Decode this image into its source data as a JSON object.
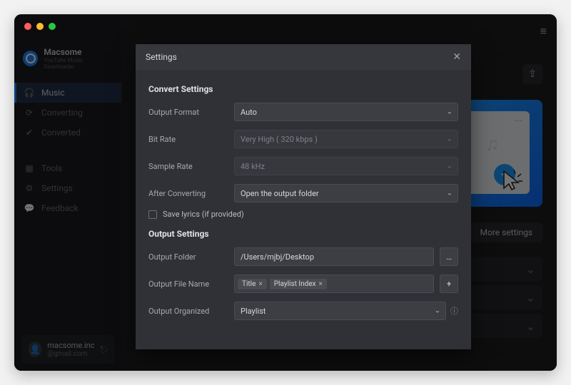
{
  "brand": {
    "name": "Macsome",
    "sub": "YouTube Music Downloader"
  },
  "sidebar": {
    "items": [
      {
        "label": "Music"
      },
      {
        "label": "Converting"
      },
      {
        "label": "Converted"
      },
      {
        "label": "Tools"
      },
      {
        "label": "Settings"
      },
      {
        "label": "Feedback"
      }
    ]
  },
  "account": {
    "name": "macsome.inc",
    "mail": "@gmail.com"
  },
  "main": {
    "more_btn": "More settings"
  },
  "modal": {
    "title": "Settings",
    "sections": {
      "convert_title": "Convert Settings",
      "output_title": "Output Settings"
    },
    "labels": {
      "output_format": "Output Format",
      "bit_rate": "Bit Rate",
      "sample_rate": "Sample Rate",
      "after_converting": "After Converting",
      "save_lyrics": "Save lyrics (if provided)",
      "output_folder": "Output Folder",
      "output_file_name": "Output File Name",
      "output_organized": "Output Organized"
    },
    "values": {
      "output_format": "Auto",
      "bit_rate": "Very High ( 320 kbps )",
      "sample_rate": "48 kHz",
      "after_converting": "Open the output folder",
      "output_folder": "/Users/mjbj/Desktop",
      "output_organized": "Playlist"
    },
    "tags": {
      "title": "Title",
      "playlist_index": "Playlist Index"
    }
  }
}
